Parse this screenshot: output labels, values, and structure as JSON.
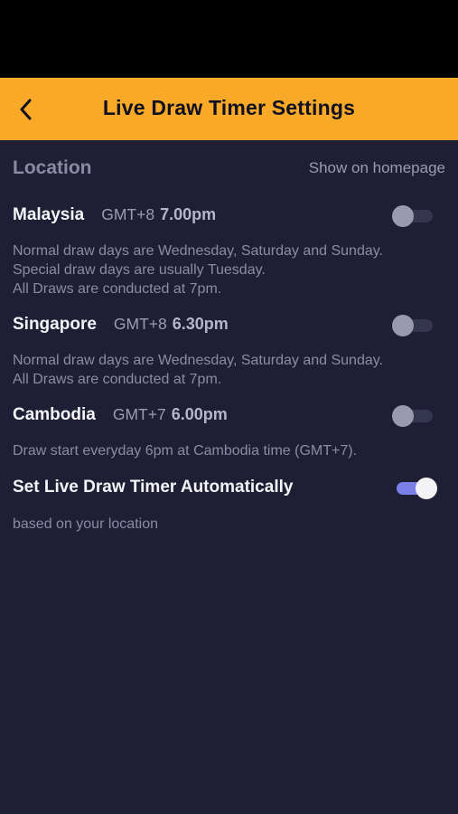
{
  "header": {
    "title": "Live Draw Timer Settings",
    "back_icon": "chevron-left-icon"
  },
  "section": {
    "title": "Location",
    "side_label": "Show on homepage"
  },
  "locations": [
    {
      "country": "Malaysia",
      "gmt": "GMT+8",
      "time": "7.00pm",
      "enabled": false,
      "description": [
        "Normal draw days are Wednesday, Saturday and Sunday.",
        "Special draw days are usually Tuesday.",
        "All Draws are conducted at 7pm."
      ]
    },
    {
      "country": "Singapore",
      "gmt": "GMT+8",
      "time": "6.30pm",
      "enabled": false,
      "description": [
        "Normal draw days are Wednesday, Saturday and Sunday.",
        "All Draws are conducted at 7pm."
      ]
    },
    {
      "country": "Cambodia",
      "gmt": "GMT+7",
      "time": "6.00pm",
      "enabled": false,
      "description": [
        "Draw start everyday 6pm at Cambodia time (GMT+7)."
      ]
    }
  ],
  "auto": {
    "title": "Set Live Draw Timer Automatically",
    "subtitle": "based on your location",
    "enabled": true
  },
  "colors": {
    "header_bg": "#f8a928",
    "page_bg": "#1e1f35",
    "toggle_on": "#7b80e6"
  }
}
